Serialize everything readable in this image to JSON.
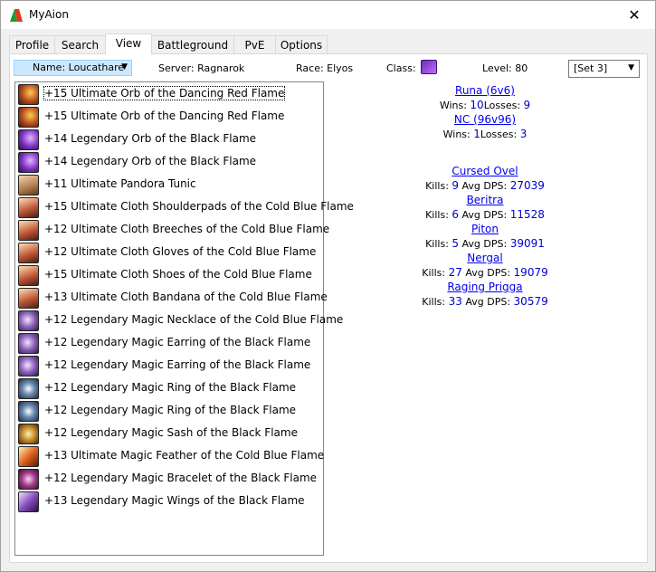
{
  "window": {
    "title": "MyAion",
    "close_glyph": "✕"
  },
  "tabs": [
    "Profile",
    "Search",
    "View",
    "Battleground",
    "PvE",
    "Options"
  ],
  "active_tab": 2,
  "character": {
    "name_label": "Name: Loucathare",
    "server": "Server: Ragnarok",
    "race": "Race: Elyos",
    "class_label": "Class:",
    "class_icon": "sorcerer-class-icon",
    "level": "Level: 80",
    "set": "[Set 3]"
  },
  "equipment": [
    {
      "label": "+15 Ultimate Orb of the Dancing Red Flame",
      "icon": "orb-red-icon"
    },
    {
      "label": "+15 Ultimate Orb of the Dancing Red Flame",
      "icon": "orb-red-icon"
    },
    {
      "label": "+14 Legendary Orb of the Black Flame",
      "icon": "orb-purple-icon"
    },
    {
      "label": "+14 Legendary Orb of the Black Flame",
      "icon": "orb-purple-icon"
    },
    {
      "label": "+11 Ultimate Pandora Tunic",
      "icon": "tunic-icon"
    },
    {
      "label": "+15 Ultimate Cloth Shoulderpads of the Cold Blue Flame",
      "icon": "cloth-icon"
    },
    {
      "label": "+12 Ultimate Cloth Breeches of the Cold Blue Flame",
      "icon": "cloth-icon"
    },
    {
      "label": "+12 Ultimate Cloth Gloves of the Cold Blue Flame",
      "icon": "cloth-icon"
    },
    {
      "label": "+15 Ultimate Cloth Shoes of the Cold Blue Flame",
      "icon": "cloth-icon"
    },
    {
      "label": "+13 Ultimate Cloth Bandana of the Cold Blue Flame",
      "icon": "cloth-icon"
    },
    {
      "label": "+12 Legendary Magic Necklace of the Cold Blue Flame",
      "icon": "jewel-icon"
    },
    {
      "label": "+12 Legendary Magic Earring of the Black Flame",
      "icon": "jewel-icon"
    },
    {
      "label": "+12 Legendary Magic Earring of the Black Flame",
      "icon": "jewel-icon"
    },
    {
      "label": "+12 Legendary Magic Ring of the Black Flame",
      "icon": "ring-icon"
    },
    {
      "label": "+12 Legendary Magic Ring of the Black Flame",
      "icon": "ring-icon"
    },
    {
      "label": "+12 Legendary Magic Sash of the Black Flame",
      "icon": "sash-icon"
    },
    {
      "label": "+13 Ultimate Magic Feather of the Cold Blue Flame",
      "icon": "feather-icon"
    },
    {
      "label": "+12 Legendary Magic Bracelet of the Black Flame",
      "icon": "bracelet-icon"
    },
    {
      "label": "+13 Legendary Magic Wings of the Black Flame",
      "icon": "wings-icon"
    }
  ],
  "selected_item": 0,
  "arena": [
    {
      "name": "Runa (6v6)",
      "wins_label": "Wins:",
      "wins": "10",
      "losses_label": "Losses:",
      "losses": "9"
    },
    {
      "name": "NC (96v96)",
      "wins_label": "Wins:",
      "wins": "1",
      "losses_label": "Losses:",
      "losses": "3"
    }
  ],
  "bosses": [
    {
      "name": "Cursed Ovel",
      "kills_label": "Kills:",
      "kills": "9",
      "dps_label": "Avg DPS:",
      "dps": "27039"
    },
    {
      "name": "Beritra",
      "kills_label": "Kills:",
      "kills": "6",
      "dps_label": "Avg DPS:",
      "dps": "11528"
    },
    {
      "name": "Piton",
      "kills_label": "Kills:",
      "kills": "5",
      "dps_label": "Avg DPS:",
      "dps": "39091"
    },
    {
      "name": "Nergal",
      "kills_label": "Kills:",
      "kills": "27",
      "dps_label": "Avg DPS:",
      "dps": "19079"
    },
    {
      "name": "Raging Prigga",
      "kills_label": "Kills:",
      "kills": "33",
      "dps_label": "Avg DPS:",
      "dps": "30579"
    }
  ],
  "colors": {
    "link": "#0000ee",
    "value": "#0000cc",
    "selection": "#cce8ff"
  }
}
